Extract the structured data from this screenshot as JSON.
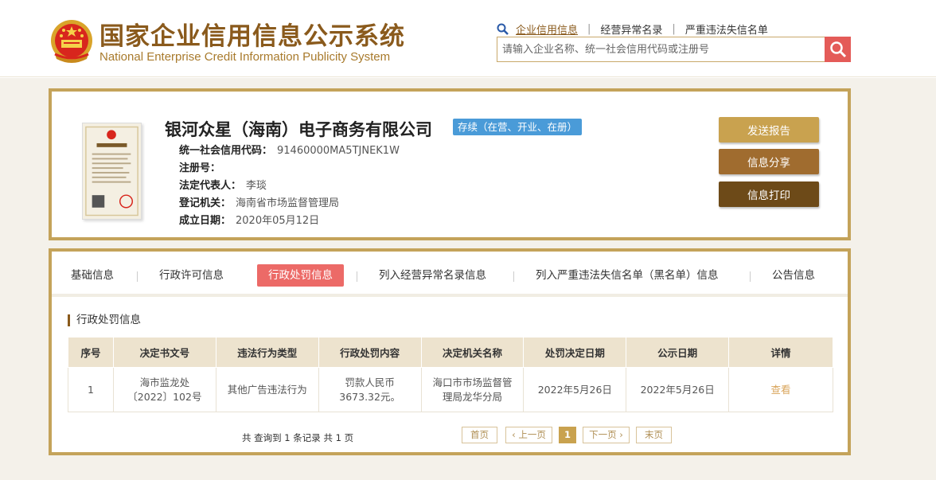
{
  "header": {
    "title_cn": "国家企业信用信息公示系统",
    "title_en": "National Enterprise Credit Information Publicity System",
    "links": [
      "企业信用信息",
      "经营异常名录",
      "严重违法失信名单"
    ],
    "link_sep": "|",
    "search_placeholder": "请输入企业名称、统一社会信用代码或注册号"
  },
  "company": {
    "name": "银河众星（海南）电子商务有限公司",
    "status": "存续（在营、开业、在册）",
    "fields": [
      {
        "label": "统一社会信用代码：",
        "value": "91460000MA5TJNEK1W"
      },
      {
        "label": "注册号：",
        "value": ""
      },
      {
        "label": "法定代表人：",
        "value": "李琰"
      },
      {
        "label": "登记机关：",
        "value": "海南省市场监督管理局"
      },
      {
        "label": "成立日期：",
        "value": "2020年05月12日"
      }
    ],
    "buttons": {
      "report": "发送报告",
      "share": "信息分享",
      "print": "信息打印"
    }
  },
  "tabs": [
    "基础信息",
    "行政许可信息",
    "行政处罚信息",
    "列入经营异常名录信息",
    "列入严重违法失信名单（黑名单）信息",
    "公告信息"
  ],
  "active_tab": "行政处罚信息",
  "section_title": "行政处罚信息",
  "table": {
    "headers": [
      "序号",
      "决定书文号",
      "违法行为类型",
      "行政处罚内容",
      "决定机关名称",
      "处罚决定日期",
      "公示日期",
      "详情"
    ],
    "rows": [
      [
        "1",
        "海市监龙处〔2022〕102号",
        "其他广告违法行为",
        "罚款人民币3673.32元。",
        "海口市市场监督管理局龙华分局",
        "2022年5月26日",
        "2022年5月26日",
        "查看"
      ]
    ]
  },
  "pagination": {
    "summary": "共 查询到 1 条记录 共 1 页",
    "first": "首页",
    "prev": "‹ 上一页",
    "current": "1",
    "next": "下一页 ›",
    "last": "末页"
  },
  "colors": {
    "gold_border": "#c4a35a",
    "brand_brown": "#8a5a1c",
    "active_tab": "#ec6a67",
    "status_blue": "#4a9bd8",
    "search_red": "#e45b58"
  }
}
